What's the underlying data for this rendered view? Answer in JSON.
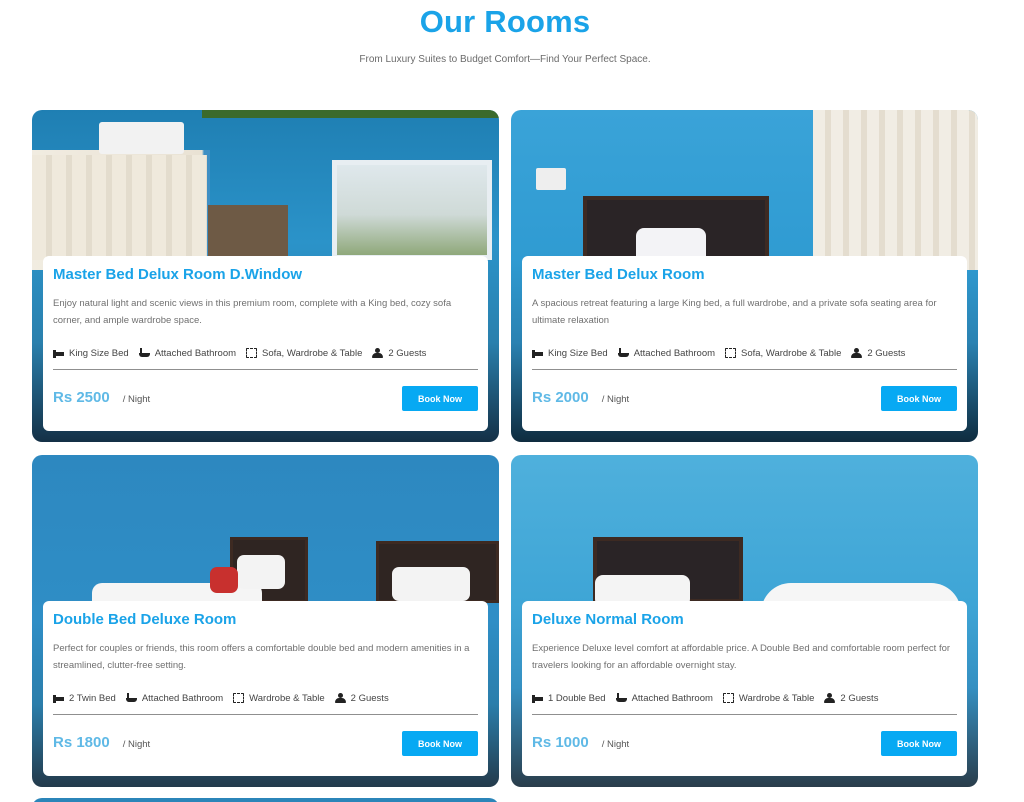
{
  "section": {
    "title": "Our Rooms",
    "subtitle": "From Luxury Suites to Budget Comfort—Find Your Perfect Space."
  },
  "rooms": [
    {
      "name": "Master Bed Delux Room D.Window",
      "description": "Enjoy natural light and scenic views in this premium room, complete with a King bed, cozy sofa corner, and ample wardrobe space.",
      "amenities": [
        {
          "icon": "bed-icon",
          "label": "King Size Bed"
        },
        {
          "icon": "bath-icon",
          "label": "Attached Bathroom"
        },
        {
          "icon": "expand-icon",
          "label": "Sofa, Wardrobe & Table"
        },
        {
          "icon": "users-icon",
          "label": "2 Guests"
        }
      ],
      "price": "Rs 2500",
      "price_unit": "/ Night",
      "button": "Book Now"
    },
    {
      "name": "Master Bed Delux Room",
      "description": "A spacious retreat featuring a large King bed, a full wardrobe, and a private sofa seating area for ultimate relaxation",
      "amenities": [
        {
          "icon": "bed-icon",
          "label": "King Size Bed"
        },
        {
          "icon": "bath-icon",
          "label": "Attached Bathroom"
        },
        {
          "icon": "expand-icon",
          "label": "Sofa, Wardrobe & Table"
        },
        {
          "icon": "users-icon",
          "label": "2 Guests"
        }
      ],
      "price": "Rs 2000",
      "price_unit": "/ Night",
      "button": "Book Now"
    },
    {
      "name": "Double Bed Deluxe Room",
      "description": "Perfect for couples or friends, this room offers a comfortable double bed and modern amenities in a streamlined, clutter-free setting.",
      "amenities": [
        {
          "icon": "bed-icon",
          "label": "2 Twin Bed"
        },
        {
          "icon": "bath-icon",
          "label": "Attached Bathroom"
        },
        {
          "icon": "expand-icon",
          "label": "Wardrobe & Table"
        },
        {
          "icon": "users-icon",
          "label": "2 Guests"
        }
      ],
      "price": "Rs 1800",
      "price_unit": "/ Night",
      "button": "Book Now"
    },
    {
      "name": "Deluxe Normal Room",
      "description": "Experience Deluxe level comfort at affordable price. A Double Bed and comfortable room perfect for travelers looking for an affordable overnight stay.",
      "amenities": [
        {
          "icon": "bed-icon",
          "label": "1 Double Bed"
        },
        {
          "icon": "bath-icon",
          "label": "Attached Bathroom"
        },
        {
          "icon": "expand-icon",
          "label": "Wardrobe & Table"
        },
        {
          "icon": "users-icon",
          "label": "2 Guests"
        }
      ],
      "price": "Rs 1000",
      "price_unit": "/ Night",
      "button": "Book Now"
    }
  ],
  "colors": {
    "accent": "#1aa3e8",
    "button": "#07a9f3",
    "price": "#5fb9e6"
  }
}
